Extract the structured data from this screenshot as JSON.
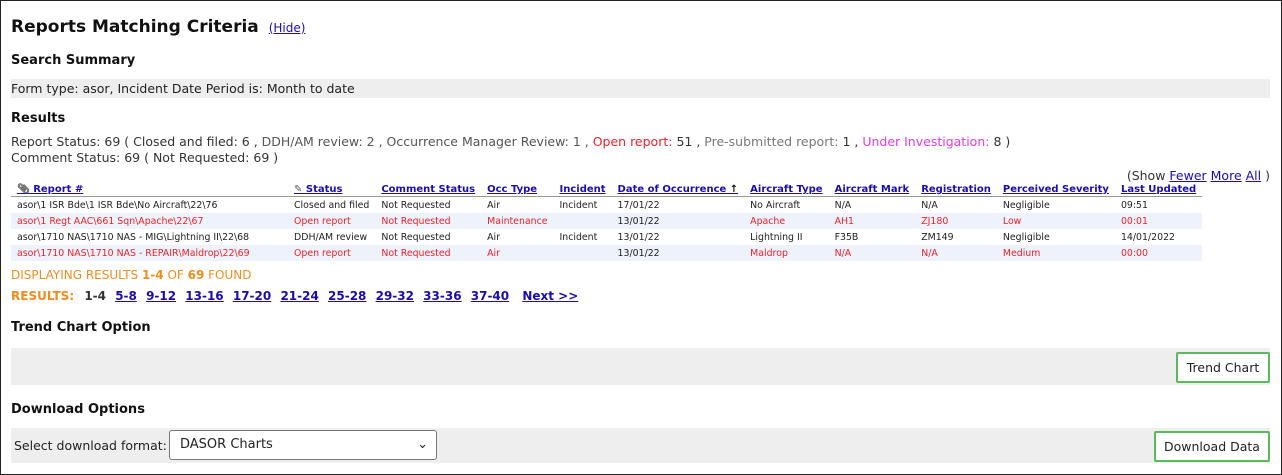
{
  "header": {
    "title": "Reports Matching Criteria",
    "hide_link": "(Hide)"
  },
  "search_summary": {
    "heading": "Search Summary",
    "text": "Form type: asor, Incident Date Period is: Month to date"
  },
  "results": {
    "heading": "Results",
    "report_status_prefix": "Report Status: 69 ( Closed and filed: 6 , ",
    "report_status_ddh": "DDH/AM review: 2 , Occurrence Manager Review: 1 , ",
    "report_status_open": "Open report: ",
    "report_status_open_count": "51 , ",
    "report_status_pre": "Pre-submitted report: ",
    "report_status_pre_count": "1 , ",
    "report_status_inv": "Under Investigation: ",
    "report_status_inv_count": "8 )",
    "comment_status": "Comment Status: 69 ( Not Requested: 69 )",
    "show_prefix": "(Show",
    "show_fewer": "Fewer",
    "show_more": "More",
    "show_all": "All",
    "show_suffix": ")",
    "columns": [
      "Report #",
      "Status",
      "Comment Status",
      "Occ Type",
      "Incident",
      "Date of Occurrence",
      "Aircraft Type",
      "Aircraft Mark",
      "Registration",
      "Perceived Severity",
      "Last Updated"
    ],
    "rows": [
      [
        "asor\\1 ISR Bde\\1 ISR Bde\\No Aircraft\\22\\76",
        "Closed and filed",
        "Not Requested",
        "Air",
        "Incident",
        "17/01/22",
        "No Aircraft",
        "N/A",
        "N/A",
        "Negligible",
        "09:51"
      ],
      [
        "asor\\1 Regt AAC\\661 Sqn\\Apache\\22\\67",
        "Open report",
        "Not Requested",
        "Maintenance",
        "",
        "13/01/22",
        "Apache",
        "AH1",
        "ZJ180",
        "Low",
        "00:01"
      ],
      [
        "asor\\1710 NAS\\1710 NAS - MIG\\Lightning II\\22\\68",
        "DDH/AM review",
        "Not Requested",
        "Air",
        "Incident",
        "13/01/22",
        "Lightning II",
        "F35B",
        "ZM149",
        "Negligible",
        "14/01/2022"
      ],
      [
        "asor\\1710 NAS\\1710 NAS - REPAIR\\Maldrop\\22\\69",
        "Open report",
        "Not Requested",
        "Air",
        "",
        "13/01/22",
        "Maldrop",
        "N/A",
        "N/A",
        "Medium",
        "00:00"
      ]
    ],
    "displaying_prefix": "DISPLAYING RESULTS ",
    "displaying_range": "1-4",
    "displaying_of": " OF ",
    "displaying_total": "69",
    "displaying_suffix": " FOUND",
    "pager_label": "RESULTS:",
    "pager_current": "1-4",
    "pager_pages": [
      "5-8",
      "9-12",
      "13-16",
      "17-20",
      "21-24",
      "25-28",
      "29-32",
      "33-36",
      "37-40",
      "Next >>"
    ]
  },
  "trend": {
    "heading": "Trend Chart Option",
    "button": "Trend Chart"
  },
  "download": {
    "heading": "Download Options",
    "select_label": "Select download format:",
    "select_value": "DASOR Charts",
    "button": "Download Data"
  },
  "colors": {
    "link": "#1a0dab",
    "red": "#e8232a",
    "orange": "#f08c1e",
    "magenta": "#e23ce2",
    "button_border": "#5cb85c"
  }
}
